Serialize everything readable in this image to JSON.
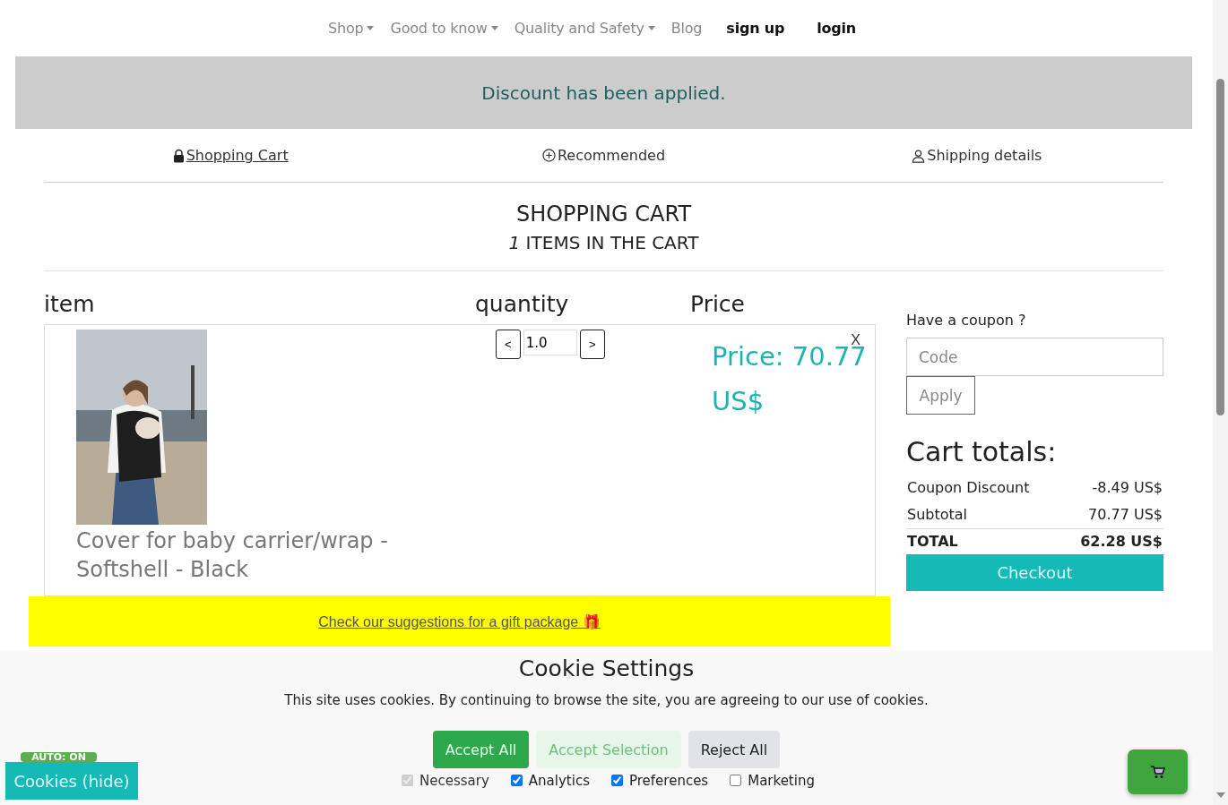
{
  "nav": {
    "items": [
      {
        "label": "Shop",
        "kind": "dropdown"
      },
      {
        "label": "Good to know",
        "kind": "dropdown"
      },
      {
        "label": "Quality and Safety",
        "kind": "dropdown"
      },
      {
        "label": "Blog",
        "kind": "link"
      },
      {
        "label": "sign up",
        "kind": "bold"
      },
      {
        "label": "login",
        "kind": "bold"
      }
    ]
  },
  "alert": "Discount has been applied.",
  "steps": [
    {
      "label": "Shopping Cart",
      "kind": "lock",
      "selected": true
    },
    {
      "label": "Recommended",
      "kind": "plus",
      "selected": false
    },
    {
      "label": "Shipping details",
      "kind": "person",
      "selected": false
    }
  ],
  "title": "SHOPPING CART",
  "subtitle": "*1* ITEMS IN THE CART",
  "table": {
    "columns": [
      "item",
      "quantity",
      "Price"
    ],
    "rows": [
      {
        "kind": "picture",
        "name": "Cover for baby carrier/wrap - Softshell - Black",
        "decrease": "<",
        "quantity": "1.0",
        "increase": ">",
        "price": "Price: 70.77 US$",
        "remove": "X"
      }
    ]
  },
  "gift_banner": {
    "link": "Check our suggestions for a gift package",
    "icon": "🎁"
  },
  "coupon": {
    "label": "Have a coupon ?",
    "placeholder": "Code",
    "button": "Apply"
  },
  "totals": {
    "title": "Cart totals:",
    "rows": [
      {
        "label": "Coupon Discount",
        "value": "-8.49 US$",
        "kind": "plain"
      },
      {
        "label": "Subtotal",
        "value": "70.77 US$",
        "kind": "plain"
      },
      {
        "label": "TOTAL",
        "value": "62.28 US$",
        "kind": "grand"
      }
    ],
    "checkout": "Checkout"
  },
  "cookies": {
    "title": "Cookie Settings",
    "text": "This site uses cookies. By continuing to browse the site, you are agreeing to our use of cookies.",
    "buttons": [
      {
        "label": "Accept All",
        "kind": "primary"
      },
      {
        "label": "Accept Selection",
        "kind": "light"
      },
      {
        "label": "Reject All",
        "kind": "secondary"
      }
    ],
    "options": [
      {
        "label": "Necessary",
        "checked": true,
        "disabled": true
      },
      {
        "label": "Analytics",
        "checked": true,
        "disabled": false
      },
      {
        "label": "Preferences",
        "checked": true,
        "disabled": false
      },
      {
        "label": "Marketing",
        "checked": false,
        "disabled": false
      }
    ]
  },
  "cookies_toggle": "Cookies (hide)",
  "auto_badge": "AUTO: ON"
}
